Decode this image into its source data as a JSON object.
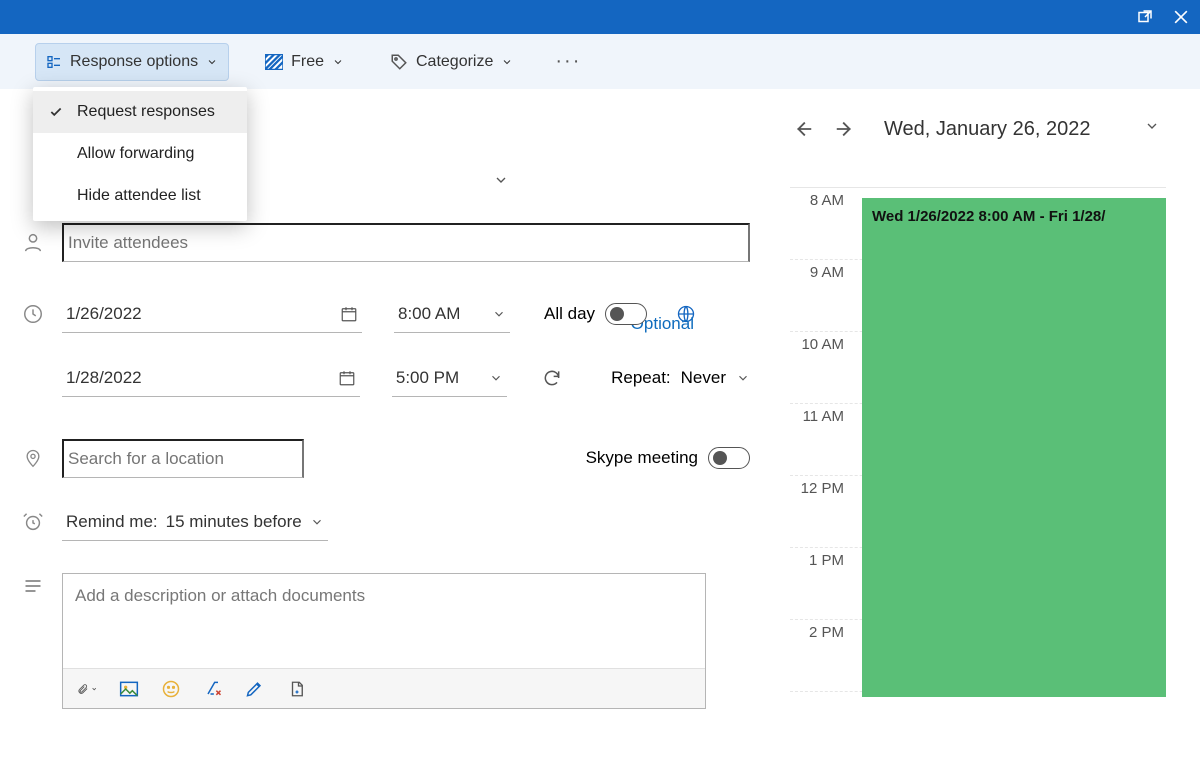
{
  "toolbar": {
    "response_options": "Response options",
    "free": "Free",
    "categorize": "Categorize"
  },
  "response_menu": {
    "request_responses": "Request responses",
    "allow_forwarding": "Allow forwarding",
    "hide_attendee_list": "Hide attendee list"
  },
  "form": {
    "attendees_placeholder": "Invite attendees",
    "optional_label": "Optional",
    "start_date": "1/26/2022",
    "start_time": "8:00 AM",
    "end_date": "1/28/2022",
    "end_time": "5:00 PM",
    "all_day_label": "All day",
    "repeat_label": "Repeat:",
    "repeat_value": "Never",
    "location_placeholder": "Search for a location",
    "skype_label": "Skype meeting",
    "remind_prefix": "Remind me:",
    "remind_value": "15 minutes before",
    "description_placeholder": "Add a description or attach documents"
  },
  "calendar": {
    "date_label": "Wed, January 26, 2022",
    "hours": [
      "8 AM",
      "9 AM",
      "10 AM",
      "11 AM",
      "12 PM",
      "1 PM",
      "2 PM"
    ],
    "event_title": "Wed 1/26/2022 8:00 AM - Fri 1/28/"
  }
}
